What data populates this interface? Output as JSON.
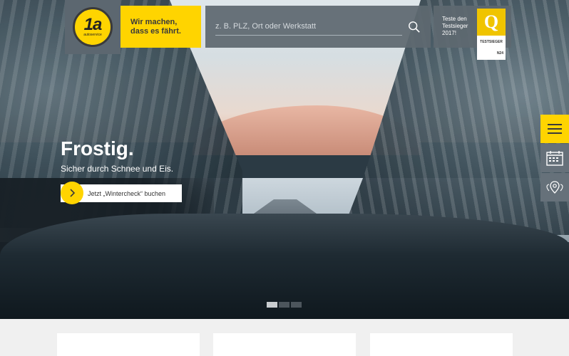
{
  "header": {
    "logo_text": "1a",
    "logo_sub": "autoservice",
    "slogan_line1": "Wir machen,",
    "slogan_line2": "dass es fährt.",
    "search_placeholder": "z. B. PLZ, Ort oder Werkstatt",
    "test_line1": "Teste den",
    "test_line2": "Testsieger",
    "test_line3": "2017!",
    "seal_mark": "Q",
    "seal_label": "TESTSIEGER",
    "seal_brand": "N24"
  },
  "hero": {
    "title": "Frostig.",
    "subtitle": "Sicher durch Schnee und Eis.",
    "cta_label": "Jetzt „Wintercheck“ buchen",
    "slides": 3,
    "active_slide": 1
  },
  "side": {
    "items": [
      "menu-icon",
      "calendar-icon",
      "location-icon"
    ]
  },
  "colors": {
    "brand_yellow": "#ffd400",
    "panel_gray": "#5e6870"
  }
}
